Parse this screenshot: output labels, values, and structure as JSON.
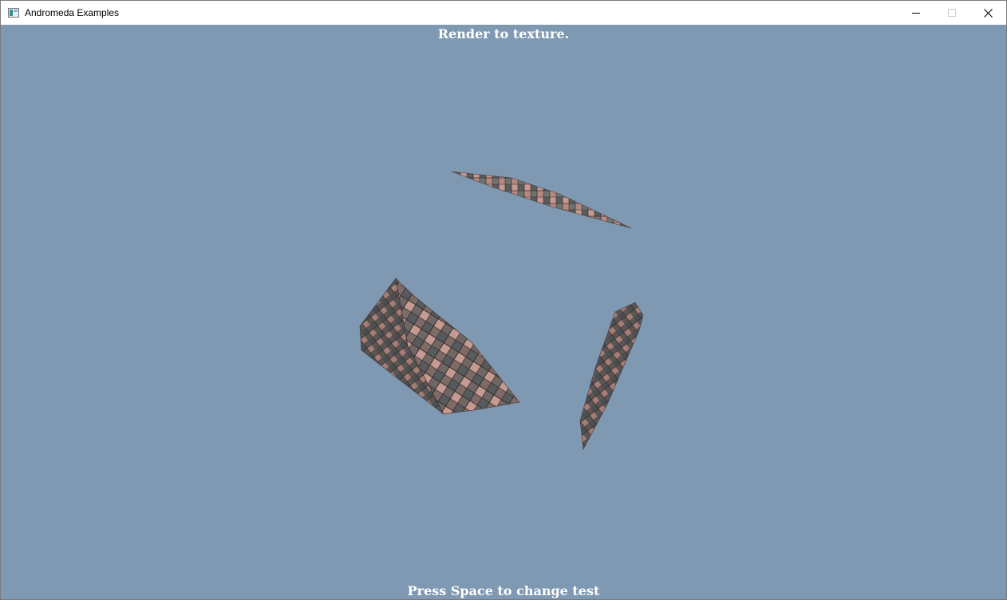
{
  "window": {
    "title": "Andromeda Examples",
    "app_icon": "app-window-icon",
    "controls": {
      "minimize_icon": "minimize-icon",
      "maximize_icon": "maximize-icon",
      "close_icon": "close-icon"
    }
  },
  "viewport": {
    "background_color": "#7f99b3",
    "header_text": "Render to texture.",
    "footer_text": "Press Space to change test"
  },
  "scene": {
    "objects": [
      "textured-box",
      "textured-plane",
      "textured-plane"
    ],
    "texture": "checkered brick tiles"
  }
}
